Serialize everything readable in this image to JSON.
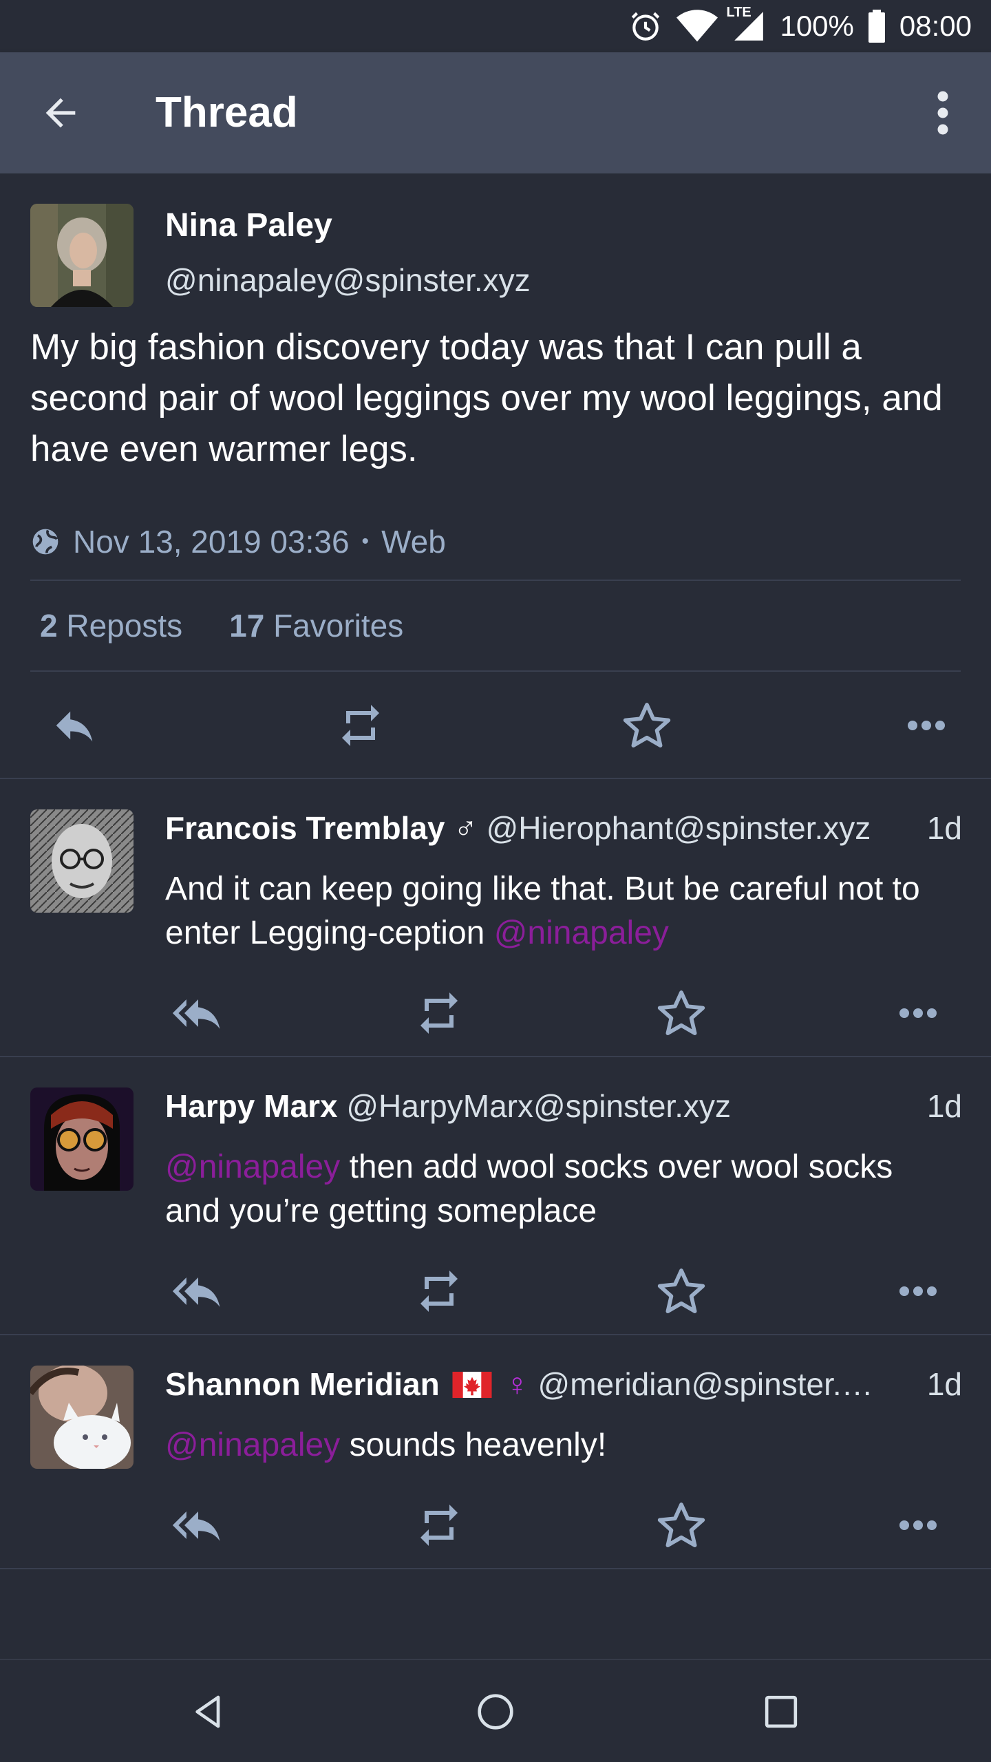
{
  "status_bar": {
    "network": "LTE",
    "battery": "100%",
    "time": "08:00"
  },
  "app_bar": {
    "title": "Thread"
  },
  "main_post": {
    "name": "Nina Paley",
    "handle": "@ninapaley@spinster.xyz",
    "content": "My big fashion discovery today was that I can pull a second pair of wool leggings over my wool leggings, and have even warmer legs.",
    "date": "Nov 13, 2019 03:36",
    "separator": "•",
    "source": "Web",
    "reposts_count": "2",
    "reposts_label": "Reposts",
    "favorites_count": "17",
    "favorites_label": "Favorites"
  },
  "replies": [
    {
      "name": "Francois Tremblay",
      "badge": "♂",
      "handle": "@Hierophant@spinster.xyz",
      "time": "1d",
      "text": "And it can keep going like that. But be careful not to enter Legging-ception ",
      "mention": "@ninapaley",
      "mention_first": false
    },
    {
      "name": "Harpy Marx",
      "badge": "",
      "handle": "@HarpyMarx@spinster.xyz",
      "time": "1d",
      "mention": "@ninapaley",
      "text": " then add wool socks over wool socks and you’re getting someplace",
      "mention_first": true
    },
    {
      "name": "Shannon Meridian",
      "badge": "♀",
      "handle": "@meridian@spinster.…",
      "time": "1d",
      "mention": "@ninapaley",
      "text": " sounds heavenly!",
      "mention_first": true
    }
  ],
  "icons": {
    "back": "arrow-left-icon",
    "overflow": "more-vert-icon",
    "globe": "globe-icon",
    "reply": "reply-icon",
    "reply_all": "reply-all-icon",
    "repost": "repost-icon",
    "favorite": "star-icon",
    "more": "more-horiz-icon"
  },
  "colors": {
    "background": "#282c37",
    "app_bar": "#444b5d",
    "icon": "#9baec8",
    "mention": "#8b1e9a"
  }
}
